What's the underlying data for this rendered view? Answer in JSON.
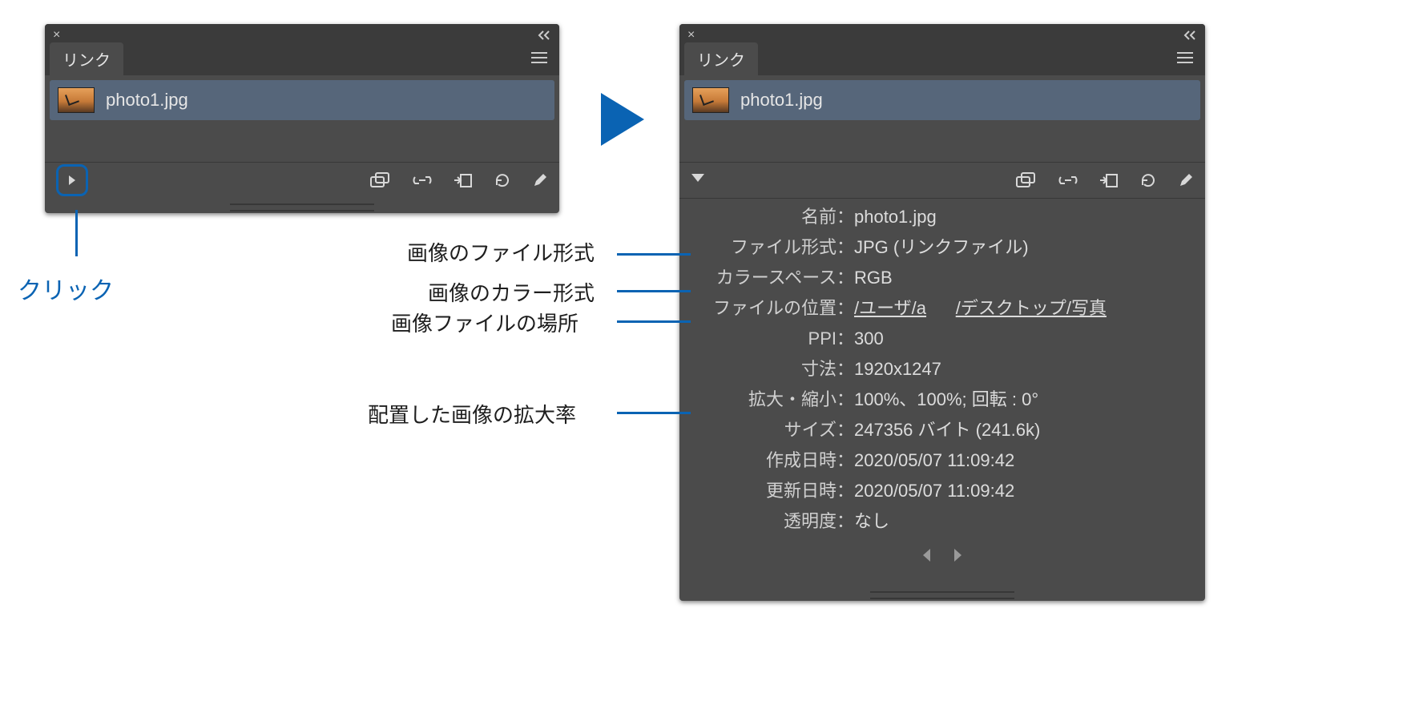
{
  "leftPanel": {
    "tab": "リンク",
    "file": "photo1.jpg"
  },
  "rightPanel": {
    "tab": "リンク",
    "file": "photo1.jpg",
    "rows": {
      "name": {
        "label": "名前",
        "value": "photo1.jpg"
      },
      "format": {
        "label": "ファイル形式",
        "value": "JPG (リンクファイル)"
      },
      "colorSpace": {
        "label": "カラースペース",
        "value": "RGB"
      },
      "location": {
        "label": "ファイルの位置",
        "path1": "/ユーザ/a",
        "path2": "/デスクトップ/写真"
      },
      "ppi": {
        "label": "PPI",
        "value": "300"
      },
      "dimensions": {
        "label": "寸法",
        "value": "1920x1247"
      },
      "scale": {
        "label": "拡大・縮小",
        "value": "100%、100%; 回転 : 0°"
      },
      "size": {
        "label": "サイズ",
        "value": "247356 バイト (241.6k)"
      },
      "created": {
        "label": "作成日時",
        "value": "2020/05/07 11:09:42"
      },
      "modified": {
        "label": "更新日時",
        "value": "2020/05/07 11:09:42"
      },
      "transparency": {
        "label": "透明度",
        "value": "なし"
      }
    }
  },
  "annotations": {
    "click": "クリック",
    "format": "画像のファイル形式",
    "color": "画像のカラー形式",
    "location": "画像ファイルの場所",
    "scale": "配置した画像の拡大率"
  },
  "sep": "："
}
